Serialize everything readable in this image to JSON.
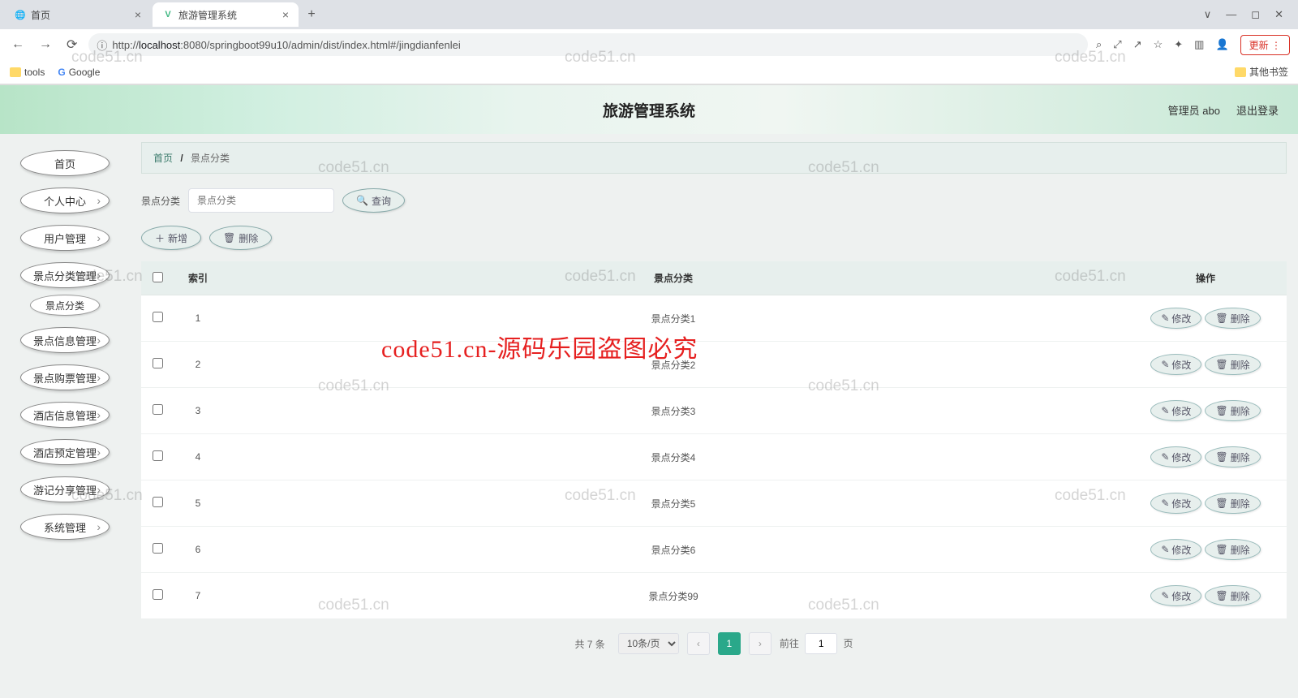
{
  "browser": {
    "tabs": [
      {
        "title": "首页",
        "active": false
      },
      {
        "title": "旅游管理系统",
        "active": true
      }
    ],
    "url_prefix": "http://",
    "url_host": "localhost",
    "url_rest": ":8080/springboot99u10/admin/dist/index.html#/jingdianfenlei",
    "update_label": "更新",
    "bookmarks": {
      "tools": "tools",
      "google": "Google",
      "other": "其他书签"
    }
  },
  "header": {
    "title": "旅游管理系统",
    "user": "管理员 abo",
    "logout": "退出登录"
  },
  "sidebar": {
    "items": [
      {
        "label": "首页",
        "sub": false
      },
      {
        "label": "个人中心",
        "sub": true
      },
      {
        "label": "用户管理",
        "sub": true
      },
      {
        "label": "景点分类管理",
        "sub": true,
        "subitem": "景点分类"
      },
      {
        "label": "景点信息管理",
        "sub": true
      },
      {
        "label": "景点购票管理",
        "sub": true
      },
      {
        "label": "酒店信息管理",
        "sub": true
      },
      {
        "label": "酒店预定管理",
        "sub": true
      },
      {
        "label": "游记分享管理",
        "sub": true
      },
      {
        "label": "系统管理",
        "sub": true
      }
    ]
  },
  "breadcrumb": {
    "home": "首页",
    "current": "景点分类"
  },
  "search": {
    "label": "景点分类",
    "placeholder": "景点分类",
    "query_btn": "查询"
  },
  "actions": {
    "add": "新增",
    "del": "删除"
  },
  "table": {
    "headers": {
      "index": "索引",
      "category": "景点分类",
      "ops": "操作"
    },
    "edit_label": "修改",
    "del_label": "删除",
    "rows": [
      {
        "idx": "1",
        "name": "景点分类1"
      },
      {
        "idx": "2",
        "name": "景点分类2"
      },
      {
        "idx": "3",
        "name": "景点分类3"
      },
      {
        "idx": "4",
        "name": "景点分类4"
      },
      {
        "idx": "5",
        "name": "景点分类5"
      },
      {
        "idx": "6",
        "name": "景点分类6"
      },
      {
        "idx": "7",
        "name": "景点分类99"
      }
    ]
  },
  "pagination": {
    "total": "共 7 条",
    "page_size": "10条/页",
    "current": "1",
    "jump_label": "前往",
    "jump_value": "1",
    "jump_suffix": "页"
  },
  "watermark": {
    "small": "code51.cn",
    "big": "code51.cn-源码乐园盗图必究"
  }
}
